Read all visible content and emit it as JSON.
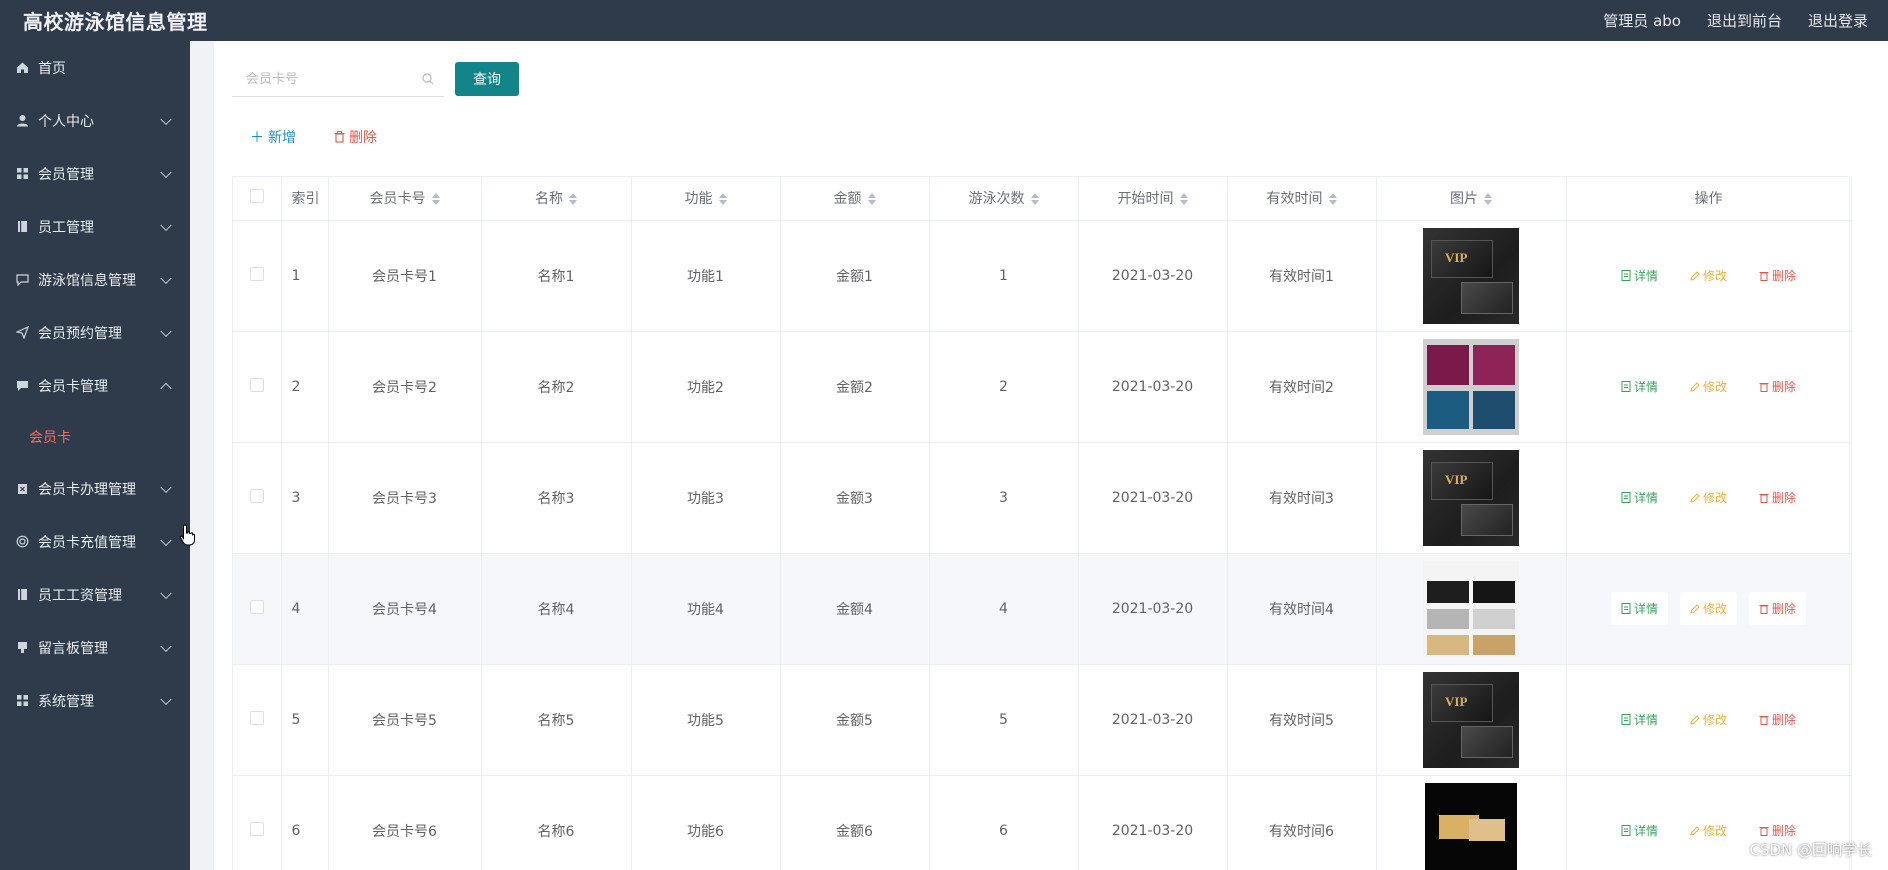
{
  "topbar": {
    "title": "高校游泳馆信息管理",
    "admin_label": "管理员 abo",
    "to_front": "退出到前台",
    "logout": "退出登录"
  },
  "sidebar": {
    "items": [
      {
        "label": "首页",
        "icon": "home-icon",
        "expandable": false
      },
      {
        "label": "个人中心",
        "icon": "user-icon",
        "expandable": true
      },
      {
        "label": "会员管理",
        "icon": "grid-icon",
        "expandable": true
      },
      {
        "label": "员工管理",
        "icon": "book-icon",
        "expandable": true
      },
      {
        "label": "游泳馆信息管理",
        "icon": "message-icon",
        "expandable": true
      },
      {
        "label": "会员预约管理",
        "icon": "send-icon",
        "expandable": true
      },
      {
        "label": "会员卡管理",
        "icon": "chat-icon",
        "expandable": true,
        "expanded": true
      },
      {
        "label": "会员卡办理管理",
        "icon": "clipboard-icon",
        "expandable": true
      },
      {
        "label": "会员卡充值管理",
        "icon": "circle-icon",
        "expandable": true
      },
      {
        "label": "员工工资管理",
        "icon": "book-icon",
        "expandable": true
      },
      {
        "label": "留言板管理",
        "icon": "pin-icon",
        "expandable": true
      },
      {
        "label": "系统管理",
        "icon": "grid-icon",
        "expandable": true
      }
    ],
    "submenu_active": "会员卡"
  },
  "search": {
    "placeholder": "会员卡号",
    "button": "查询"
  },
  "actions": {
    "add": "新增",
    "delete": "删除"
  },
  "table": {
    "headers": [
      "索引",
      "会员卡号",
      "名称",
      "功能",
      "金额",
      "游泳次数",
      "开始时间",
      "有效时间",
      "图片",
      "操作"
    ],
    "op_labels": {
      "detail": "详情",
      "edit": "修改",
      "remove": "删除"
    },
    "rows": [
      {
        "index": "1",
        "card_no": "会员卡号1",
        "name": "名称1",
        "func": "功能1",
        "amount": "金额1",
        "swims": "1",
        "start": "2021-03-20",
        "valid": "有效时间1",
        "img": "dark"
      },
      {
        "index": "2",
        "card_no": "会员卡号2",
        "name": "名称2",
        "func": "功能2",
        "amount": "金额2",
        "swims": "2",
        "start": "2021-03-20",
        "valid": "有效时间2",
        "img": "color"
      },
      {
        "index": "3",
        "card_no": "会员卡号3",
        "name": "名称3",
        "func": "功能3",
        "amount": "金额3",
        "swims": "3",
        "start": "2021-03-20",
        "valid": "有效时间3",
        "img": "dark"
      },
      {
        "index": "4",
        "card_no": "会员卡号4",
        "name": "名称4",
        "func": "功能4",
        "amount": "金额4",
        "swims": "4",
        "start": "2021-03-20",
        "valid": "有效时间4",
        "img": "light"
      },
      {
        "index": "5",
        "card_no": "会员卡号5",
        "name": "名称5",
        "func": "功能5",
        "amount": "金额5",
        "swims": "5",
        "start": "2021-03-20",
        "valid": "有效时间5",
        "img": "dark"
      },
      {
        "index": "6",
        "card_no": "会员卡号6",
        "name": "名称6",
        "func": "功能6",
        "amount": "金额6",
        "swims": "6",
        "start": "2021-03-20",
        "valid": "有效时间6",
        "img": "black"
      }
    ],
    "hover_row": 3
  },
  "watermark": "CSDN @回响学长",
  "colors": {
    "sidebar_bg": "#2f3a4a",
    "primary_button": "#12858a",
    "active_submenu": "#ff6b57",
    "detail": "#3aa35b",
    "edit": "#f0b03c",
    "remove": "#e2574c",
    "add": "#1e8ec9"
  }
}
